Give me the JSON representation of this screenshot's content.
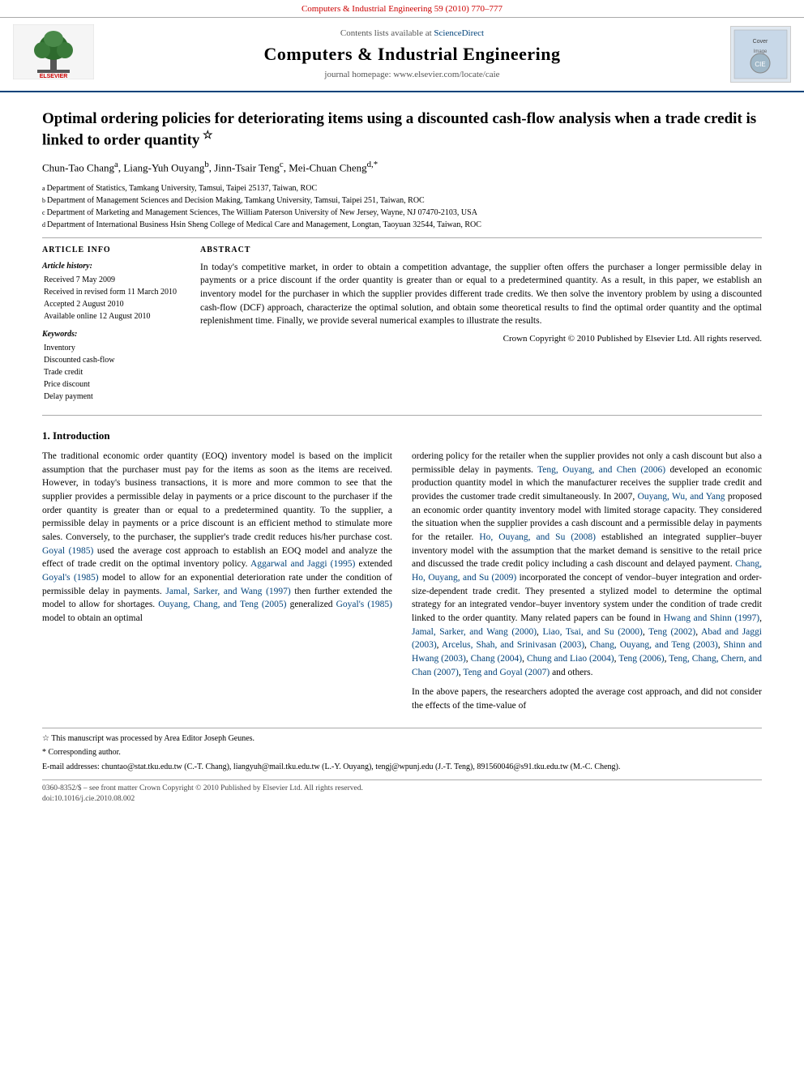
{
  "top_bar": {
    "text": "Computers & Industrial Engineering 59 (2010) 770–777"
  },
  "journal_header": {
    "sciencedirect_text": "Contents lists available at ",
    "sciencedirect_link": "ScienceDirect",
    "title": "Computers & Industrial Engineering",
    "homepage_text": "journal homepage: www.elsevier.com/locate/caie"
  },
  "paper": {
    "title": "Optimal ordering policies for deteriorating items using a discounted cash-flow analysis when a trade credit is linked to order quantity",
    "title_star": "☆",
    "authors": "Chun-Tao Chang",
    "author_a": "a",
    "author2": ", Liang-Yuh Ouyang",
    "author_b": "b",
    "author3": ", Jinn-Tsair Teng",
    "author_c": "c",
    "author4": ", Mei-Chuan Cheng",
    "author_d": "d,*",
    "affiliations": [
      {
        "sup": "a",
        "text": "Department of Statistics, Tamkang University, Tamsui, Taipei 25137, Taiwan, ROC"
      },
      {
        "sup": "b",
        "text": "Department of Management Sciences and Decision Making, Tamkang University, Tamsui, Taipei 251, Taiwan, ROC"
      },
      {
        "sup": "c",
        "text": "Department of Marketing and Management Sciences, The William Paterson University of New Jersey, Wayne, NJ 07470-2103, USA"
      },
      {
        "sup": "d",
        "text": "Department of International Business Hsin Sheng College of Medical Care and Management, Longtan, Taoyuan 32544, Taiwan, ROC"
      }
    ]
  },
  "article_info": {
    "heading": "ARTICLE INFO",
    "history_label": "Article history:",
    "dates": [
      "Received 7 May 2009",
      "Received in revised form 11 March 2010",
      "Accepted 2 August 2010",
      "Available online 12 August 2010"
    ],
    "keywords_label": "Keywords:",
    "keywords": [
      "Inventory",
      "Discounted cash-flow",
      "Trade credit",
      "Price discount",
      "Delay payment"
    ]
  },
  "abstract": {
    "heading": "ABSTRACT",
    "text": "In today's competitive market, in order to obtain a competition advantage, the supplier often offers the purchaser a longer permissible delay in payments or a price discount if the order quantity is greater than or equal to a predetermined quantity. As a result, in this paper, we establish an inventory model for the purchaser in which the supplier provides different trade credits. We then solve the inventory problem by using a discounted cash-flow (DCF) approach, characterize the optimal solution, and obtain some theoretical results to find the optimal order quantity and the optimal replenishment time. Finally, we provide several numerical examples to illustrate the results.",
    "copyright": "Crown Copyright © 2010 Published by Elsevier Ltd. All rights reserved."
  },
  "intro": {
    "heading": "1. Introduction",
    "col1_paragraphs": [
      "The traditional economic order quantity (EOQ) inventory model is based on the implicit assumption that the purchaser must pay for the items as soon as the items are received. However, in today's business transactions, it is more and more common to see that the supplier provides a permissible delay in payments or a price discount to the purchaser if the order quantity is greater than or equal to a predetermined quantity. To the supplier, a permissible delay in payments or a price discount is an efficient method to stimulate more sales. Conversely, to the purchaser, the supplier's trade credit reduces his/her purchase cost. Goyal (1985) used the average cost approach to establish an EOQ model and analyze the effect of trade credit on the optimal inventory policy. Aggarwal and Jaggi (1995) extended Goyal's (1985) model to allow for an exponential deterioration rate under the condition of permissible delay in payments. Jamal, Sarker, and Wang (1997) then further extended the model to allow for shortages. Ouyang, Chang, and Teng (2005) generalized Goyal's (1985) model to obtain an optimal"
    ],
    "col2_paragraphs": [
      "ordering policy for the retailer when the supplier provides not only a cash discount but also a permissible delay in payments. Teng, Ouyang, and Chen (2006) developed an economic production quantity model in which the manufacturer receives the supplier trade credit and provides the customer trade credit simultaneously. In 2007, Ouyang, Wu, and Yang proposed an economic order quantity inventory model with limited storage capacity. They considered the situation when the supplier provides a cash discount and a permissible delay in payments for the retailer. Ho, Ouyang, and Su (2008) established an integrated supplier–buyer inventory model with the assumption that the market demand is sensitive to the retail price and discussed the trade credit policy including a cash discount and delayed payment. Chang, Ho, Ouyang, and Su (2009) incorporated the concept of vendor–buyer integration and order-size-dependent trade credit. They presented a stylized model to determine the optimal strategy for an integrated vendor–buyer inventory system under the condition of trade credit linked to the order quantity. Many related papers can be found in Hwang and Shinn (1997), Jamal, Sarker, and Wang (2000), Liao, Tsai, and Su (2000), Teng (2002), Abad and Jaggi (2003), Arcelus, Shah, and Srinivasan (2003), Chang, Ouyang, and Teng (2003), Shinn and Hwang (2003), Chang (2004), Chung and Liao (2004), Teng (2006), Teng, Chang, Chern, and Chan (2007), Teng and Goyal (2007) and others.",
      "In the above papers, the researchers adopted the average cost approach, and did not consider the effects of the time-value of"
    ]
  },
  "footnotes": [
    "☆  This manuscript was processed by Area Editor Joseph Geunes.",
    "*  Corresponding author.",
    "E-mail addresses: chuntao@stat.tku.edu.tw (C.-T. Chang), liangyuh@mail.tku.edu.tw (L.-Y. Ouyang), tengj@wpunj.edu (J.-T. Teng), 891560046@s91.tku.edu.tw (M.-C. Cheng)."
  ],
  "bottom_bar": {
    "text": "0360-8352/$ – see front matter Crown Copyright © 2010 Published by Elsevier Ltd. All rights reserved.",
    "doi": "doi:10.1016/j.cie.2010.08.002"
  }
}
